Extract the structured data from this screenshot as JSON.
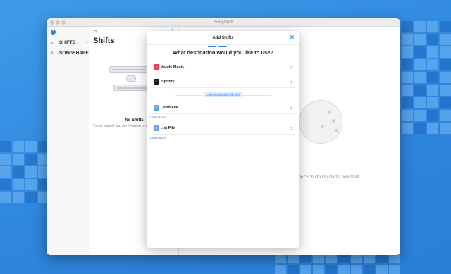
{
  "window": {
    "title": "SongShift"
  },
  "sidebar": {
    "top_icon": "S",
    "items": [
      {
        "label": "SHIFTS",
        "icon": "shift-wave-icon",
        "glyph": "∿",
        "chevron": "›"
      },
      {
        "label": "SONGSHARE",
        "icon": "share-icon",
        "glyph": "≋"
      }
    ]
  },
  "list": {
    "toolbar_icon": "⇆",
    "plus": "+",
    "title": "Shifts",
    "empty_title": "No Shifts",
    "empty_subtitle": "To get started, tap the + button to create a new Shift."
  },
  "detail": {
    "hint": "the \"+\" button to start a new Shift."
  },
  "modal": {
    "title": "Add Shifts",
    "close": "✕",
    "question": "What destination would you like to use?",
    "destinations": [
      {
        "label": "Apple Music",
        "icon": "apple-music-icon",
        "glyph": "♪",
        "color": "#f2394b",
        "chevron": "›"
      },
      {
        "label": "Spotify",
        "icon": "spotify-icon",
        "glyph": "≡",
        "color": "#1ed760",
        "chevron": "›"
      },
      {
        "label": ".json File",
        "icon": "json-file-icon",
        "glyph": "≡",
        "color": "#6b9ee8",
        "chevron": "›"
      },
      {
        "label": ".txt File",
        "icon": "txt-file-icon",
        "glyph": "≡",
        "color": "#6b9ee8",
        "chevron": "›"
      }
    ],
    "connect_label": "Connect another service",
    "learn_more": "Learn More"
  },
  "colors": {
    "accent": "#2f7de1",
    "background": "#2e86de"
  }
}
